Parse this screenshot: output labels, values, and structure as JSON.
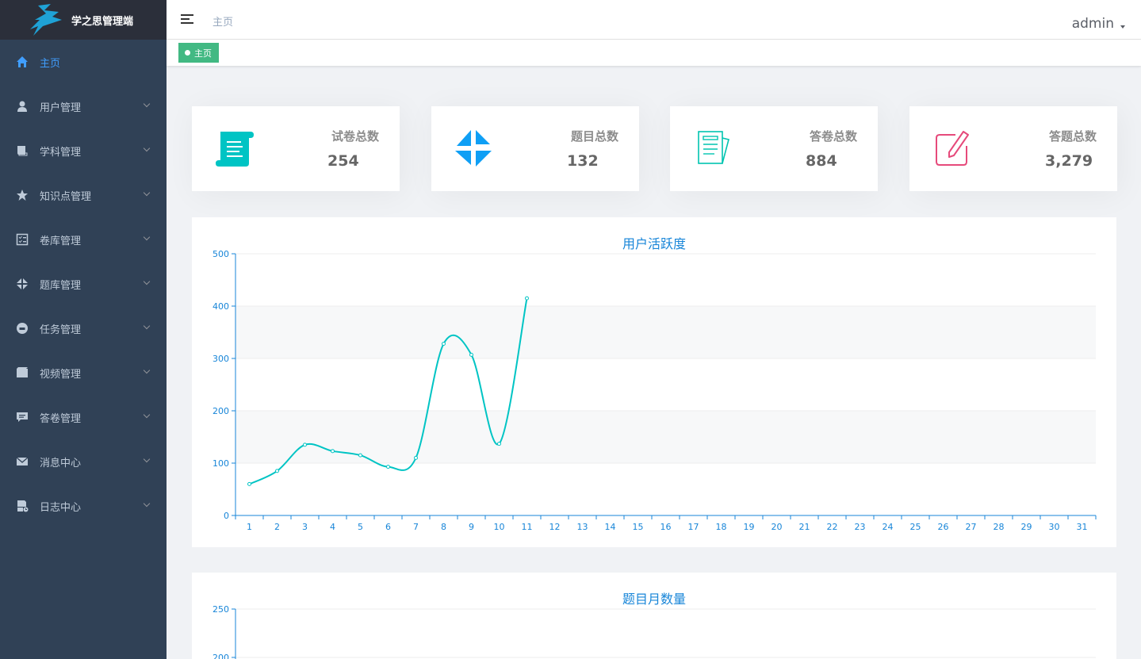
{
  "app": {
    "title": "学之思管理端"
  },
  "sidebar": {
    "items": [
      {
        "label": "主页",
        "icon": "home-icon",
        "active": true
      },
      {
        "label": "用户管理",
        "icon": "user-icon"
      },
      {
        "label": "学科管理",
        "icon": "book-icon"
      },
      {
        "label": "知识点管理",
        "icon": "star-icon"
      },
      {
        "label": "卷库管理",
        "icon": "checklist-icon"
      },
      {
        "label": "题库管理",
        "icon": "pinwheel-icon"
      },
      {
        "label": "任务管理",
        "icon": "task-icon"
      },
      {
        "label": "视频管理",
        "icon": "video-icon"
      },
      {
        "label": "答卷管理",
        "icon": "comment-icon"
      },
      {
        "label": "消息中心",
        "icon": "mail-icon"
      },
      {
        "label": "日志中心",
        "icon": "log-icon"
      }
    ]
  },
  "header": {
    "breadcrumb": "主页",
    "user": "admin"
  },
  "tags": [
    {
      "label": "主页"
    }
  ],
  "cards": [
    {
      "label": "试卷总数",
      "value": "254",
      "icon": "scroll-icon",
      "color": "#00c4c4"
    },
    {
      "label": "题目总数",
      "value": "132",
      "icon": "pinwheel-icon",
      "color": "#0f9ff5"
    },
    {
      "label": "答卷总数",
      "value": "884",
      "icon": "documents-icon",
      "color": "#00c4b0"
    },
    {
      "label": "答题总数",
      "value": "3,279",
      "icon": "edit-icon",
      "color": "#e64a7b"
    }
  ],
  "colors": {
    "sidebar": "#304156",
    "accent": "#409eff",
    "line": "#00c4c4",
    "axis": "#1785d8",
    "tag": "#42b983"
  },
  "chart_data": [
    {
      "type": "line",
      "title": "用户活跃度",
      "x": [
        1,
        2,
        3,
        4,
        5,
        6,
        7,
        8,
        9,
        10,
        11,
        12,
        13,
        14,
        15,
        16,
        17,
        18,
        19,
        20,
        21,
        22,
        23,
        24,
        25,
        26,
        27,
        28,
        29,
        30,
        31
      ],
      "values": [
        60,
        85,
        135,
        123,
        115,
        93,
        110,
        328,
        307,
        137,
        415
      ],
      "ylim": [
        0,
        500
      ],
      "yticks": [
        0,
        100,
        200,
        300,
        400,
        500
      ]
    },
    {
      "type": "line",
      "title": "题目月数量",
      "ylim": [
        0,
        250
      ],
      "yticks": [
        200,
        250
      ],
      "yticks_display": [
        "200",
        "250"
      ]
    }
  ]
}
